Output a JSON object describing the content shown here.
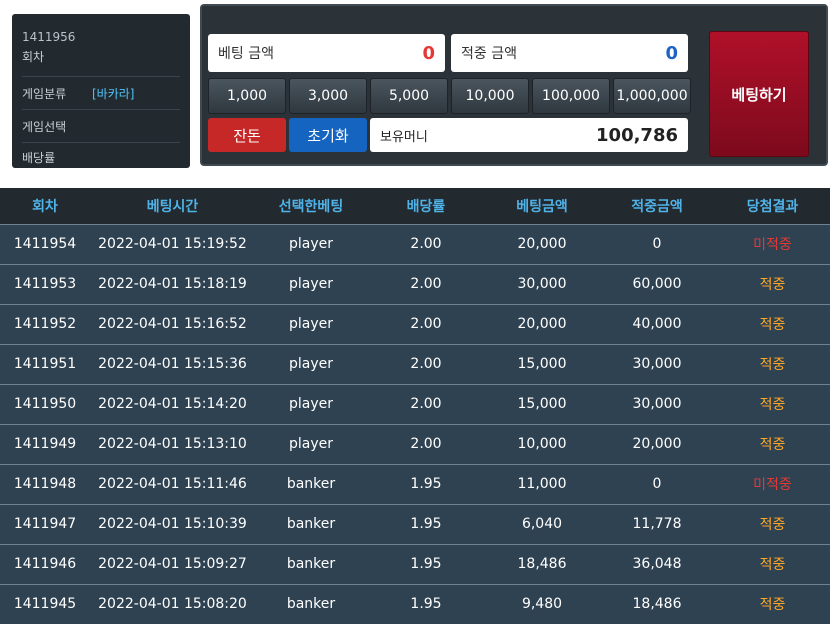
{
  "info": {
    "round_number": "1411956",
    "round_label": "회차",
    "game_category_label": "게임분류",
    "game_category_value": "[바카라]",
    "game_select_label": "게임선택",
    "odds_label": "배당률"
  },
  "bet": {
    "bet_amount_label": "베팅 금액",
    "bet_amount_value": "0",
    "win_amount_label": "적중 금액",
    "win_amount_value": "0",
    "chips": [
      "1,000",
      "3,000",
      "5,000",
      "10,000",
      "100,000",
      "1,000,000"
    ],
    "jandon_label": "잔돈",
    "reset_label": "초기화",
    "money_label": "보유머니",
    "money_value": "100,786",
    "submit_label": "베팅하기"
  },
  "table": {
    "headers": [
      "회차",
      "베팅시간",
      "선택한베팅",
      "배당률",
      "베팅금액",
      "적중금액",
      "당첨결과"
    ],
    "rows": [
      [
        "1411954",
        "2022-04-01 15:19:52",
        "player",
        "2.00",
        "20,000",
        "0",
        "미적중"
      ],
      [
        "1411953",
        "2022-04-01 15:18:19",
        "player",
        "2.00",
        "30,000",
        "60,000",
        "적중"
      ],
      [
        "1411952",
        "2022-04-01 15:16:52",
        "player",
        "2.00",
        "20,000",
        "40,000",
        "적중"
      ],
      [
        "1411951",
        "2022-04-01 15:15:36",
        "player",
        "2.00",
        "15,000",
        "30,000",
        "적중"
      ],
      [
        "1411950",
        "2022-04-01 15:14:20",
        "player",
        "2.00",
        "15,000",
        "30,000",
        "적중"
      ],
      [
        "1411949",
        "2022-04-01 15:13:10",
        "player",
        "2.00",
        "10,000",
        "20,000",
        "적중"
      ],
      [
        "1411948",
        "2022-04-01 15:11:46",
        "banker",
        "1.95",
        "11,000",
        "0",
        "미적중"
      ],
      [
        "1411947",
        "2022-04-01 15:10:39",
        "banker",
        "1.95",
        "6,040",
        "11,778",
        "적중"
      ],
      [
        "1411946",
        "2022-04-01 15:09:27",
        "banker",
        "1.95",
        "18,486",
        "36,048",
        "적중"
      ],
      [
        "1411945",
        "2022-04-01 15:08:20",
        "banker",
        "1.95",
        "9,480",
        "18,486",
        "적중"
      ]
    ]
  },
  "colors": {
    "miss": "#e53935",
    "hit": "#ffa726",
    "header_text": "#4fb3e8",
    "row_bg": "#2f4252",
    "bet_button": "#b0102a"
  }
}
